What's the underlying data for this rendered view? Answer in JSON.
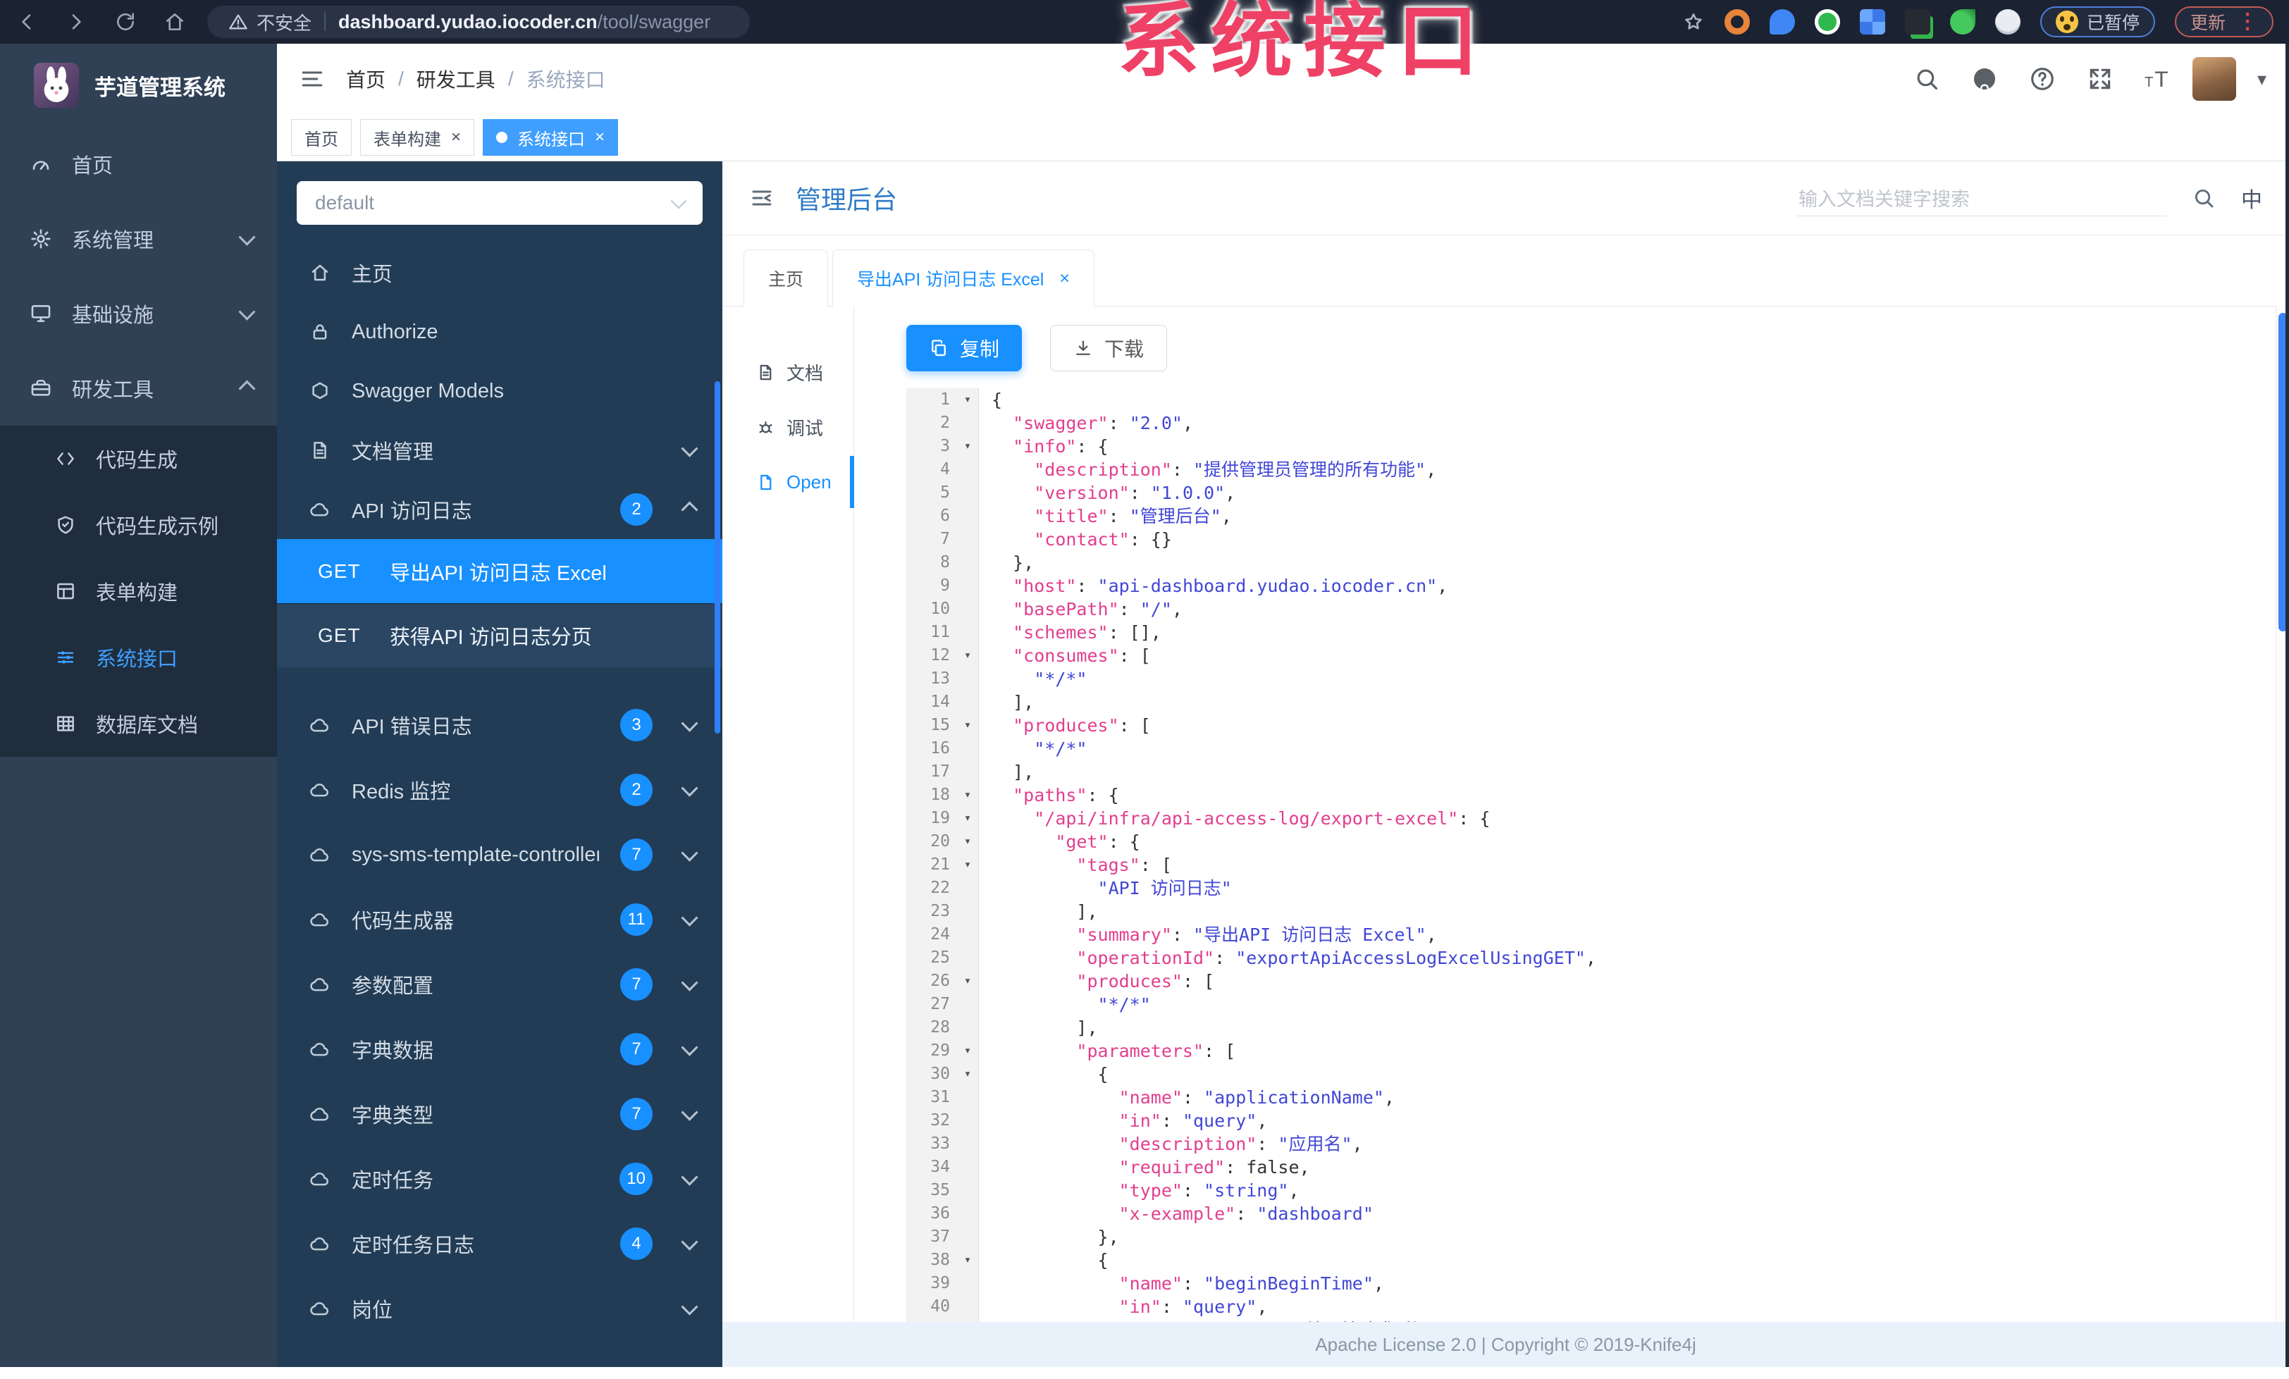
{
  "annotation": {
    "text": "系统接口",
    "color": "#ef4166"
  },
  "browser": {
    "nav_icons": [
      "back-icon",
      "forward-icon",
      "reload-icon",
      "home-icon"
    ],
    "security_label": "不安全",
    "url_host": "dashboard.yudao.iocoder.cn",
    "url_path": "/tool/swagger",
    "extension_icons": [
      "orange-ring-extension-icon",
      "blue-pin-extension-icon",
      "green-circle-extension-icon",
      "blue-grid-extension-icon",
      "dark-green-tag-extension-icon",
      "green-leaf-extension-icon",
      "white-paw-extension-icon"
    ],
    "paused_label": "已暂停",
    "update_label": "更新"
  },
  "sidebar": {
    "app_title": "芋道管理系统",
    "items": [
      {
        "label": "首页",
        "icon": "gauge-icon",
        "chevron": ""
      },
      {
        "label": "系统管理",
        "icon": "gear-icon",
        "chevron": "down"
      },
      {
        "label": "基础设施",
        "icon": "monitor-icon",
        "chevron": "down"
      },
      {
        "label": "研发工具",
        "icon": "toolbox-icon",
        "chevron": "up"
      }
    ],
    "sub_items": [
      {
        "label": "代码生成",
        "icon": "code-icon",
        "active": false
      },
      {
        "label": "代码生成示例",
        "icon": "shield-icon",
        "active": false
      },
      {
        "label": "表单构建",
        "icon": "form-icon",
        "active": false
      },
      {
        "label": "系统接口",
        "icon": "sliders-icon",
        "active": true
      },
      {
        "label": "数据库文档",
        "icon": "table-icon",
        "active": false
      }
    ]
  },
  "navbar": {
    "breadcrumb": [
      "首页",
      "研发工具",
      "系统接口"
    ],
    "right_icons": [
      "search-icon",
      "github-icon",
      "help-icon",
      "fullscreen-icon",
      "font-size-icon"
    ]
  },
  "tags_view": [
    {
      "label": "首页",
      "closable": false,
      "active": false
    },
    {
      "label": "表单构建",
      "closable": true,
      "active": false
    },
    {
      "label": "系统接口",
      "closable": true,
      "active": true
    }
  ],
  "swagger_nav": {
    "group_value": "default",
    "items": [
      {
        "label": "主页",
        "icon": "home-icon",
        "chevron": "",
        "badge": "",
        "expanded": false
      },
      {
        "label": "Authorize",
        "icon": "lock-icon",
        "chevron": "",
        "badge": "",
        "expanded": false
      },
      {
        "label": "Swagger Models",
        "icon": "hexagon-icon",
        "chevron": "",
        "badge": "",
        "expanded": false
      },
      {
        "label": "文档管理",
        "icon": "doc-icon",
        "chevron": "down",
        "badge": "",
        "expanded": false
      },
      {
        "label": "API 访问日志",
        "icon": "cloud-icon",
        "chevron": "up",
        "badge": "2",
        "expanded": true
      }
    ],
    "operations": [
      {
        "method": "GET",
        "label": "导出API 访问日志 Excel",
        "active": true
      },
      {
        "method": "GET",
        "label": "获得API 访问日志分页",
        "active": false
      }
    ],
    "controllers": [
      {
        "label": "API 错误日志",
        "icon": "cloud-icon",
        "badge": "3"
      },
      {
        "label": "Redis 监控",
        "icon": "cloud-icon",
        "badge": "2"
      },
      {
        "label": "sys-sms-template-controller",
        "icon": "cloud-icon",
        "badge": "7"
      },
      {
        "label": "代码生成器",
        "icon": "cloud-icon",
        "badge": "11"
      },
      {
        "label": "参数配置",
        "icon": "cloud-icon",
        "badge": "7"
      },
      {
        "label": "字典数据",
        "icon": "cloud-icon",
        "badge": "7"
      },
      {
        "label": "字典类型",
        "icon": "cloud-icon",
        "badge": "7"
      },
      {
        "label": "定时任务",
        "icon": "cloud-icon",
        "badge": "10"
      },
      {
        "label": "定时任务日志",
        "icon": "cloud-icon",
        "badge": "4"
      },
      {
        "label": "岗位",
        "icon": "cloud-icon",
        "badge": ""
      }
    ]
  },
  "doc_header": {
    "title": "管理后台",
    "search_placeholder": "输入文档关键字搜索",
    "lang_label": "中"
  },
  "doc_tabs": [
    {
      "label": "主页",
      "closable": false,
      "active": false
    },
    {
      "label": "导出API 访问日志 Excel",
      "closable": true,
      "active": true
    }
  ],
  "mini_nav": [
    {
      "label": "文档",
      "icon": "doc-icon",
      "active": false
    },
    {
      "label": "调试",
      "icon": "debug-icon",
      "active": false
    },
    {
      "label": "Open",
      "icon": "file-icon",
      "active": true
    }
  ],
  "toolbar": {
    "copy_label": "复制",
    "download_label": "下载"
  },
  "code": {
    "fold_lines": [
      1,
      3,
      12,
      15,
      18,
      19,
      20,
      21,
      26,
      29,
      30,
      38
    ],
    "lines": [
      "{",
      "  \"swagger\": \"2.0\",",
      "  \"info\": {",
      "    \"description\": \"提供管理员管理的所有功能\",",
      "    \"version\": \"1.0.0\",",
      "    \"title\": \"管理后台\",",
      "    \"contact\": {}",
      "  },",
      "  \"host\": \"api-dashboard.yudao.iocoder.cn\",",
      "  \"basePath\": \"/\",",
      "  \"schemes\": [],",
      "  \"consumes\": [",
      "    \"*/*\"",
      "  ],",
      "  \"produces\": [",
      "    \"*/*\"",
      "  ],",
      "  \"paths\": {",
      "    \"/api/infra/api-access-log/export-excel\": {",
      "      \"get\": {",
      "        \"tags\": [",
      "          \"API 访问日志\"",
      "        ],",
      "        \"summary\": \"导出API 访问日志 Excel\",",
      "        \"operationId\": \"exportApiAccessLogExcelUsingGET\",",
      "        \"produces\": [",
      "          \"*/*\"",
      "        ],",
      "        \"parameters\": [",
      "          {",
      "            \"name\": \"applicationName\",",
      "            \"in\": \"query\",",
      "            \"description\": \"应用名\",",
      "            \"required\": false,",
      "            \"type\": \"string\",",
      "            \"x-example\": \"dashboard\"",
      "          },",
      "          {",
      "            \"name\": \"beginBeginTime\",",
      "            \"in\": \"query\",",
      "            \"description\": \"开始开始请求时间\""
    ]
  },
  "footer": {
    "text": "Apache License 2.0 | Copyright © 2019-Knife4j"
  },
  "colors": {
    "accent": "#1890ff",
    "element_accent": "#409eff",
    "sidebar_bg": "#304156",
    "swagger_sidebar_bg": "#223c55",
    "code_key": "#e23e8f",
    "code_value": "#4147d5"
  }
}
